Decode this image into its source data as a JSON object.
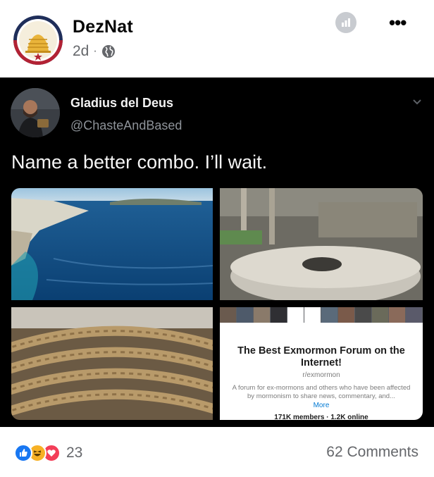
{
  "post": {
    "page_name": "DezNat",
    "time": "2d",
    "separator": "·",
    "audience_icon": "globe-icon",
    "more_label": "•••"
  },
  "tweet": {
    "author_name": "Gladius del Deus",
    "author_handle": "@ChasteAndBased",
    "text": "Name a better combo. I’ll wait."
  },
  "reddit_card": {
    "title": "The Best Exmormon Forum on the Internet!",
    "subreddit": "r/exmormon",
    "description": "A forum for ex-mormons and others who have been affected by mormonism to share news, commentary, and...",
    "more": "More",
    "stats": "171K members · 1.2K online"
  },
  "footer": {
    "reaction_count": "23",
    "comments": "62 Comments"
  },
  "colors": {
    "like": "#1877f2",
    "haha": "#f7b125",
    "love": "#f33e58",
    "secondary_text": "#65676b",
    "tweet_bg": "#000000"
  }
}
